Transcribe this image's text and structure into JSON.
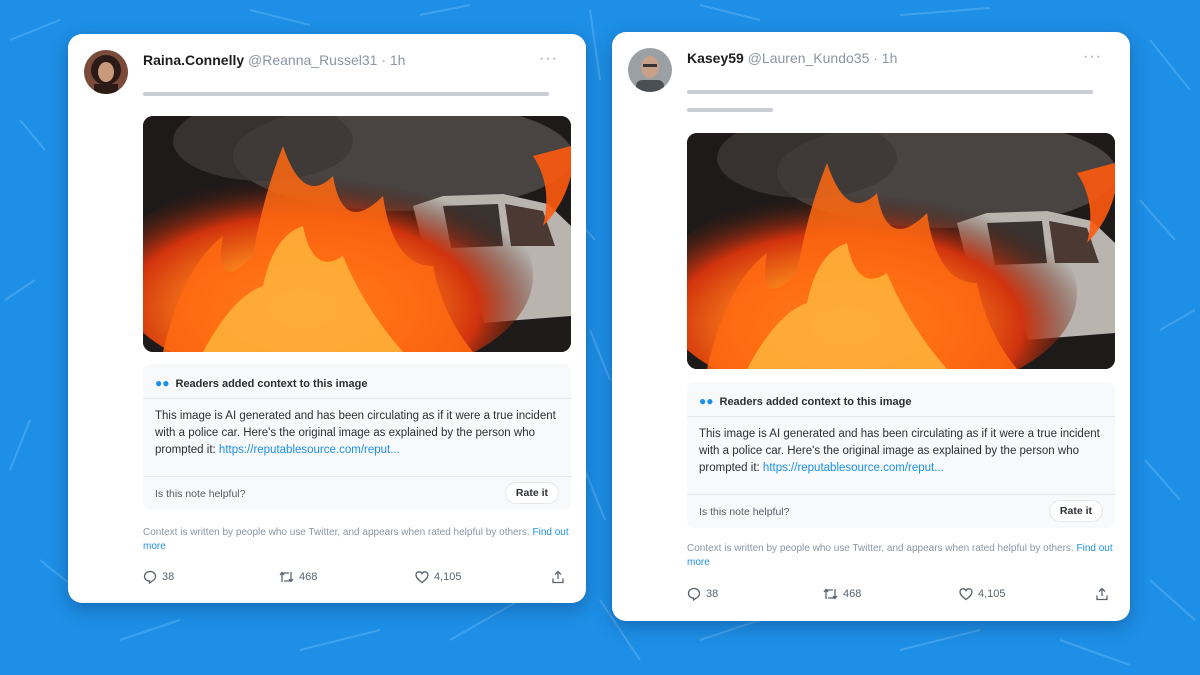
{
  "colors": {
    "background": "#1d8fe6",
    "link": "#1d8fe6",
    "note_bg": "#f7f9fa"
  },
  "tweets": [
    {
      "display_name": "Raina.Connelly",
      "handle_time": "@Reanna_Russel31 · 1h",
      "more_icon": "more-horizontal-icon",
      "note": {
        "header": "Readers added context to this image",
        "body": "This image is AI generated and has been circulating as if it were a true incident with a police car. Here's the original image as explained by the person who prompted it: ",
        "link": "https://reputablesource.com/reput...",
        "helpful_question": "Is this note helpful?",
        "rate_label": "Rate it"
      },
      "context_text": "Context is written by people who use Twitter, and appears when rated helpful by others. ",
      "find_out_more": "Find out more",
      "replies": "38",
      "retweets": "468",
      "likes": "4,105"
    },
    {
      "display_name": "Kasey59",
      "handle_time": "@Lauren_Kundo35 · 1h",
      "more_icon": "more-horizontal-icon",
      "note": {
        "header": "Readers added context to this image",
        "body": "This image is AI generated and has been circulating as if it were a true incident with a police car. Here's the original image as explained by the person who prompted it: ",
        "link": "https://reputablesource.com/reput...",
        "helpful_question": "Is this note helpful?",
        "rate_label": "Rate it"
      },
      "context_text": "Context is written by people who use Twitter, and appears when rated helpful by others. ",
      "find_out_more": "Find out more",
      "replies": "38",
      "retweets": "468",
      "likes": "4,105"
    }
  ]
}
